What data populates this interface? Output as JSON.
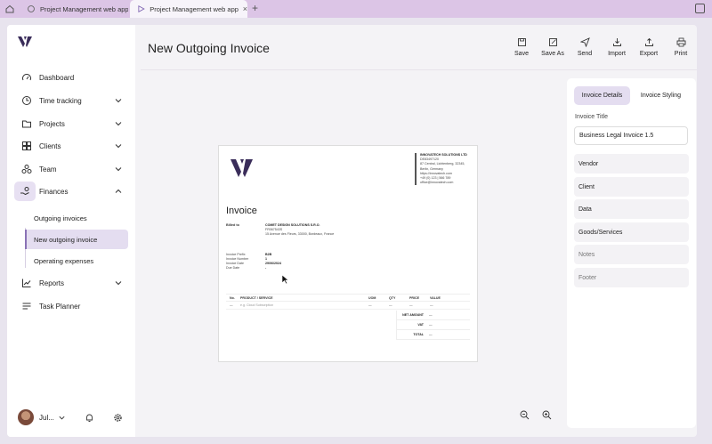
{
  "browser": {
    "tabs": [
      {
        "label": "Project Management web app"
      },
      {
        "label": "Project Management web app - I"
      }
    ],
    "close_glyph": "×",
    "add_glyph": "+"
  },
  "sidebar": {
    "items": [
      {
        "label": "Dashboard",
        "icon": "gauge-icon"
      },
      {
        "label": "Time tracking",
        "icon": "clock-icon"
      },
      {
        "label": "Projects",
        "icon": "folder-icon"
      },
      {
        "label": "Clients",
        "icon": "clients-icon"
      },
      {
        "label": "Team",
        "icon": "team-icon"
      },
      {
        "label": "Finances",
        "icon": "hand-coins-icon"
      },
      {
        "label": "Reports",
        "icon": "chart-line-icon"
      },
      {
        "label": "Task Planner",
        "icon": "list-icon"
      }
    ],
    "finance_sub": [
      {
        "label": "Outgoing invoices"
      },
      {
        "label": "New outgoing invoice"
      },
      {
        "label": "Operating expenses"
      }
    ],
    "user_name": "Jul..."
  },
  "header": {
    "title": "New Outgoing Invoice",
    "toolbar": {
      "save": "Save",
      "save_as": "Save As",
      "send": "Send",
      "import": "Import",
      "export": "Export",
      "print": "Print"
    }
  },
  "invoice": {
    "company": {
      "name": "INNOVATECH SOLUTIONS LTD",
      "lines": [
        "DE83497120",
        "87 Central, Lichtenberg, 32345,",
        "Berlin, Germany",
        "https://innovatech.com",
        "+49 (0) 123 | 566 789",
        "office@innovatech.com"
      ]
    },
    "title": "Invoice",
    "billed_to_label": "Billed to",
    "client": {
      "name": "COMET DESIGN SOLUTIONS S.R.O.",
      "lines": [
        "FR067543S",
        "15 Avenue des Fleurs, 33000, Bordeaux, France"
      ]
    },
    "meta_labels": [
      "Invoice Prefix",
      "Invoice Number",
      "Invoice Date",
      "Due Date"
    ],
    "meta_values": [
      "B2B",
      "1",
      "29/06/2024",
      "-"
    ],
    "table": {
      "headers": [
        "No.",
        "PRODUCT / SERVICE",
        "UOM",
        "QTY",
        "PRICE",
        "VALUE"
      ],
      "rows": [
        [
          "—",
          "e.g. Cloud Subscription",
          "—",
          "—",
          "—",
          "—"
        ]
      ]
    },
    "totals": [
      {
        "label": "NET AMOUNT",
        "value": "—"
      },
      {
        "label": "VAT",
        "value": "—"
      },
      {
        "label": "TOTAL",
        "value": "—"
      }
    ]
  },
  "panel": {
    "tabs": {
      "details": "Invoice Details",
      "styling": "Invoice Styling"
    },
    "title_label": "Invoice Title",
    "title_value": "Business Legal Invoice 1.5",
    "sections": [
      "Vendor",
      "Client",
      "Data",
      "Goods/Services",
      "Notes",
      "Footer"
    ]
  },
  "colors": {
    "accent": "#8a72b6",
    "accent_light": "#e4ddf0",
    "tabbar": "#dcc5e6"
  }
}
